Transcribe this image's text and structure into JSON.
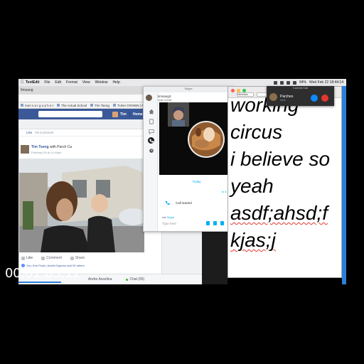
{
  "menubar": {
    "app": "TextEdit",
    "items": [
      "File",
      "Edit",
      "Format",
      "View",
      "Window",
      "Help"
    ],
    "clock": "Wed Feb 22  18:44:14",
    "battery": "94%"
  },
  "browser": {
    "tab": "Ilmsang",
    "bookmarks": [
      "mon s a r g o p h e t",
      "The Actual School",
      "Tim Tseng",
      "TUNA CROWN | Fre..."
    ],
    "user_name": "Tim",
    "home_label": "Home",
    "post": {
      "like_row_a": "Like",
      "like_row_b": "Hit Comment",
      "author": "Tim Tseng",
      "with": "with Parch Ca",
      "date": "February 05 at 11:49pm",
      "actions": [
        "Like",
        "Comment",
        "Share"
      ],
      "reactions": "You, Erin Pouln, Andrie Dapono and 99 others"
    },
    "chat_bar_name": "Andre Asselina",
    "chat_label": "Chat (65)"
  },
  "skype": {
    "window_title": "Skype",
    "my_name": "timsang3",
    "add_credit": "Add Credit",
    "today": "Today",
    "timestamp": "ts 4:20",
    "call_started": "Call started",
    "via": "via",
    "via_service": "Skype",
    "type_here": "Type here"
  },
  "current_call": {
    "header": "Current Call",
    "name": "Parches",
    "status": "Mute"
  },
  "textedit": {
    "font_name": "Helvetica",
    "lines": [
      "working",
      "circus",
      "i believe so",
      "yeah",
      "asdf;ahsd;f",
      "kjas;j"
    ]
  },
  "timecode": "00:01:03;12",
  "colors": {
    "facebook_blue": "#3b5998",
    "skype_blue": "#00aff0",
    "spell_red": "#e3372e"
  }
}
